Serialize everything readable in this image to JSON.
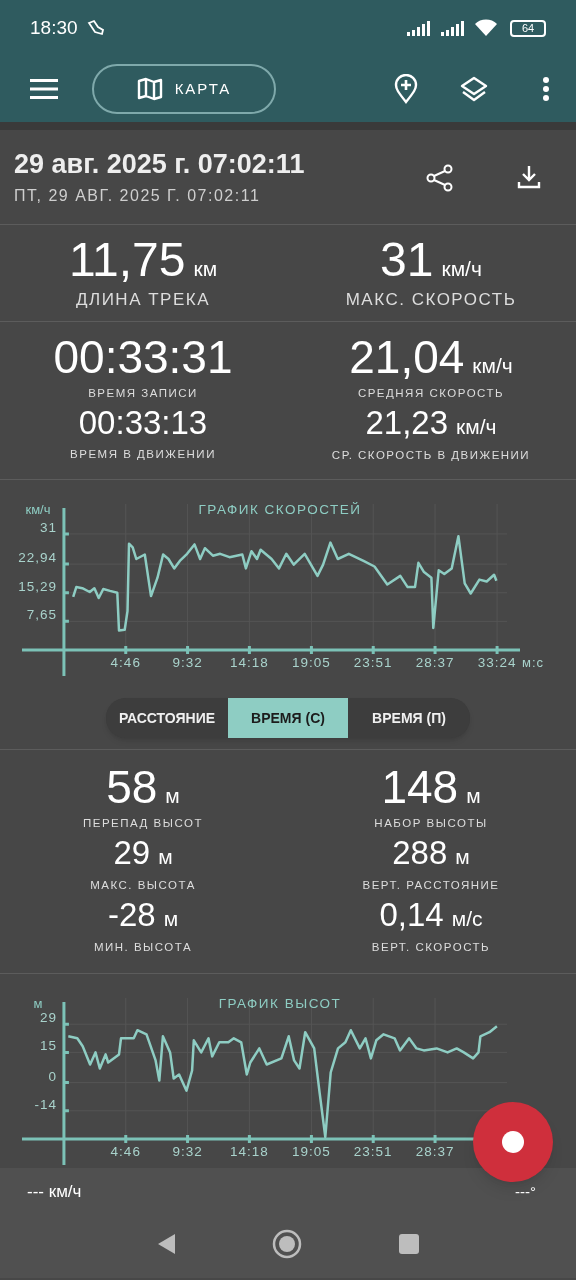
{
  "status_bar": {
    "time": "18:30",
    "battery": "64"
  },
  "toolbar": {
    "map_button": "КАРТА"
  },
  "header": {
    "title": "29 авг. 2025 г. 07:02:11",
    "subtitle": "ПТ, 29 АВГ. 2025 Г. 07:02:11"
  },
  "speed_stats": [
    {
      "kind": "large",
      "cells": [
        {
          "value": "11,75",
          "unit": "км",
          "label": "ДЛИНА ТРЕКА"
        },
        {
          "value": "31",
          "unit": "км/ч",
          "label": "МАКС. СКОРОСТЬ"
        }
      ]
    },
    {
      "kind": "medium",
      "cells": [
        {
          "value": "00:33:31",
          "label": "ВРЕМЯ ЗАПИСИ"
        },
        {
          "value": "21,04",
          "unit": "км/ч",
          "label": "СРЕДНЯЯ СКОРОСТЬ"
        }
      ]
    },
    {
      "kind": "small",
      "cells": [
        {
          "value": "00:33:13",
          "label": "ВРЕМЯ В ДВИЖЕНИИ"
        },
        {
          "value": "21,23",
          "unit": "км/ч",
          "label": "СР. СКОРОСТЬ В ДВИЖЕНИИ"
        }
      ]
    }
  ],
  "speed_chart": {
    "chart_data": {
      "type": "line",
      "title": "ГРАФИК СКОРОСТЕЙ",
      "ylabel": "км/ч",
      "xlabel": "м:с",
      "xlim": [
        -194,
        2110
      ],
      "ylim": [
        0,
        39
      ],
      "grid": true,
      "xticks": [
        {
          "value": 286,
          "label": "4:46"
        },
        {
          "value": 572,
          "label": "9:32"
        },
        {
          "value": 858,
          "label": "14:18"
        },
        {
          "value": 1145,
          "label": "19:05"
        },
        {
          "value": 1431,
          "label": "23:51"
        },
        {
          "value": 1717,
          "label": "28:37"
        },
        {
          "value": 2004,
          "label": "33:24"
        }
      ],
      "yticks": [
        {
          "value": 7.65,
          "label": "7,65"
        },
        {
          "value": 15.29,
          "label": "15,29"
        },
        {
          "value": 22.94,
          "label": "22,94"
        },
        {
          "value": 31,
          "label": "31"
        }
      ],
      "x": [
        43,
        57,
        85,
        119,
        141,
        161,
        182,
        213,
        247,
        255,
        281,
        294,
        301,
        318,
        335,
        374,
        403,
        433,
        459,
        484,
        510,
        536,
        570,
        604,
        630,
        652,
        689,
        723,
        766,
        825,
        842,
        868,
        893,
        910,
        961,
        995,
        1029,
        1063,
        1114,
        1173,
        1199,
        1233,
        1267,
        1318,
        1386,
        1437,
        1496,
        1556,
        1590,
        1624,
        1640,
        1666,
        1700,
        1709,
        1734,
        1760,
        1794,
        1825,
        1854,
        1882,
        1922,
        1956,
        1990,
        2001
      ],
      "series": [
        {
          "color": "#8ecdc3",
          "values": [
            14.2,
            16.8,
            16.5,
            15.5,
            16.5,
            13.9,
            16.3,
            15.8,
            15.3,
            5.2,
            5.4,
            10.4,
            28.4,
            27.4,
            24.3,
            25.5,
            14.4,
            19.3,
            25.5,
            24.3,
            21.8,
            23.8,
            25.7,
            28.2,
            24.3,
            27.2,
            25.2,
            25.7,
            24.8,
            25.5,
            21.8,
            26.4,
            24.3,
            26.8,
            24.3,
            21.8,
            25.7,
            22.8,
            25.7,
            19.8,
            22.8,
            28.7,
            24.3,
            25.7,
            23.8,
            22.3,
            17.5,
            19.8,
            16.8,
            16.8,
            23.3,
            20.8,
            19.3,
            5.9,
            21.3,
            20.3,
            21.8,
            30.4,
            17.8,
            15.1,
            18.8,
            18.3,
            20.1,
            18.5
          ]
        }
      ]
    }
  },
  "x_axis_modes": [
    {
      "label": "РАССТОЯНИЕ",
      "selected": false
    },
    {
      "label": "ВРЕМЯ (С)",
      "selected": true
    },
    {
      "label": "ВРЕМЯ (П)",
      "selected": false
    }
  ],
  "altitude_stats": [
    {
      "kind": "medium",
      "cells": [
        {
          "value": "58",
          "unit": "м",
          "label": "ПЕРЕПАД ВЫСОТ"
        },
        {
          "value": "148",
          "unit": "м",
          "label": "НАБОР ВЫСОТЫ"
        }
      ]
    },
    {
      "kind": "small",
      "cells": [
        {
          "value": "29",
          "unit": "м",
          "label": "МАКС. ВЫСОТА"
        },
        {
          "value": "288",
          "unit": "м",
          "label": "ВЕРТ. РАССТОЯНИЕ"
        }
      ]
    },
    {
      "kind": "small",
      "cells": [
        {
          "value": "-28",
          "unit": "м",
          "label": "МИН. ВЫСОТА"
        },
        {
          "value": "0,14",
          "unit": "м/с",
          "label": "ВЕРТ. СКОРОСТЬ"
        }
      ]
    }
  ],
  "altitude_chart": {
    "chart_data": {
      "type": "line",
      "title": "ГРАФИК ВЫСОТ",
      "ylabel": "м",
      "xlim": [
        -194,
        2110
      ],
      "ylim": [
        -28,
        42
      ],
      "grid": true,
      "xticks": [
        {
          "value": 286,
          "label": "4:46"
        },
        {
          "value": 572,
          "label": "9:32"
        },
        {
          "value": 858,
          "label": "14:18"
        },
        {
          "value": 1145,
          "label": "19:05"
        },
        {
          "value": 1431,
          "label": "23:51"
        },
        {
          "value": 1717,
          "label": "28:37"
        }
      ],
      "yticks": [
        {
          "value": -14,
          "label": "-14"
        },
        {
          "value": 0,
          "label": "0"
        },
        {
          "value": 15,
          "label": "15"
        },
        {
          "value": 29,
          "label": "29"
        }
      ],
      "x": [
        20,
        62,
        87,
        121,
        146,
        166,
        193,
        205,
        255,
        264,
        323,
        340,
        382,
        424,
        441,
        458,
        491,
        508,
        533,
        567,
        593,
        601,
        635,
        669,
        686,
        719,
        761,
        786,
        820,
        846,
        862,
        904,
        938,
        1006,
        1040,
        1065,
        1090,
        1116,
        1158,
        1183,
        1209,
        1234,
        1268,
        1302,
        1327,
        1369,
        1395,
        1420,
        1445,
        1479,
        1530,
        1555,
        1597,
        1631,
        1665,
        1724,
        1775,
        1817,
        1850,
        1893,
        1918,
        1927,
        1969,
        2003
      ],
      "series": [
        {
          "color": "#8ecdc3",
          "values": [
            23,
            22,
            18,
            9,
            15,
            7,
            14,
            10,
            14,
            22,
            22,
            26,
            24,
            11,
            1,
            23,
            15,
            2,
            4,
            -4,
            6,
            21,
            15,
            22,
            13,
            20,
            20,
            22,
            20,
            4,
            10,
            17,
            9,
            12,
            23,
            11,
            7,
            25,
            17,
            -5,
            -27,
            5,
            17,
            20,
            26,
            17,
            22,
            12,
            21,
            24,
            22,
            16,
            22,
            17,
            16,
            17,
            15,
            17,
            15,
            12,
            15,
            23,
            25,
            28
          ]
        }
      ]
    }
  },
  "bottom_bar": {
    "speed": "--- км/ч",
    "heading": "---°"
  }
}
